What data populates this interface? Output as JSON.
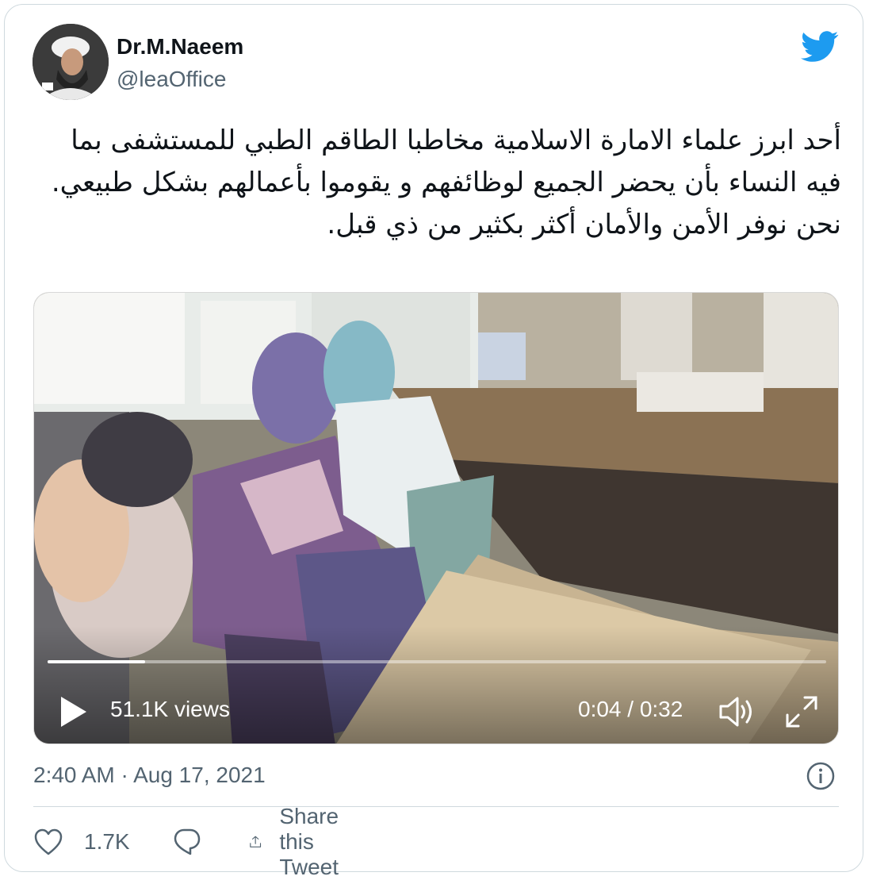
{
  "user": {
    "name": "Dr.M.Naeem",
    "handle": "@leaOffice"
  },
  "tweet": {
    "text": "أحد ابرز علماء الامارة الاسلامية مخاطبا الطاقم الطبي للمستشفى بما فيه النساء بأن يحضر الجميع لوظائفهم و يقوموا بأعمالهم بشكل طبيعي. نحن نوفر الأمن والأمان أكثر بكثير من ذي قبل.",
    "timestamp": "2:40 AM · Aug 17, 2021"
  },
  "video": {
    "views": "51.1K views",
    "time": "0:04 / 0:32",
    "progress_fraction": 0.125
  },
  "actions": {
    "like_count": "1.7K",
    "share_label": "Share this Tweet"
  },
  "colors": {
    "brand": "#1d9bf0",
    "text": "#0f1419",
    "muted": "#536471",
    "border": "#cfd9de"
  },
  "icons": {
    "brand": "twitter-bird-icon",
    "play": "play-icon",
    "volume": "volume-icon",
    "fullscreen": "fullscreen-icon",
    "info": "info-icon",
    "like": "heart-icon",
    "reply": "reply-icon",
    "share": "share-icon"
  }
}
